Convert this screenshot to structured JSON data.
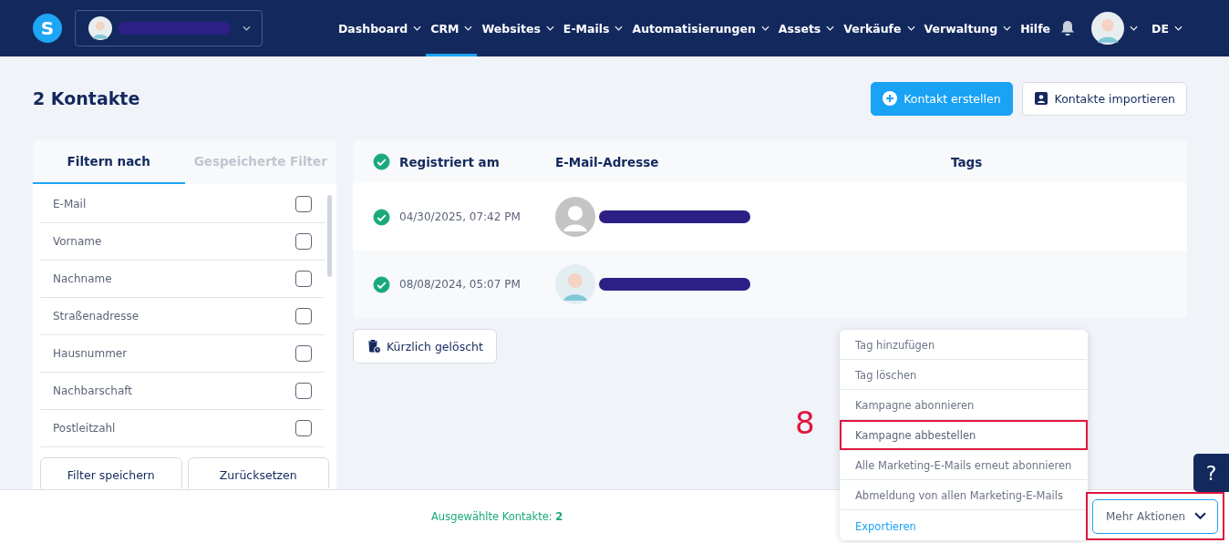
{
  "nav": {
    "logo": "S",
    "items": [
      {
        "label": "Dashboard",
        "dropdown": true,
        "selected": false
      },
      {
        "label": "CRM",
        "dropdown": true,
        "selected": true
      },
      {
        "label": "Websites",
        "dropdown": true,
        "selected": false
      },
      {
        "label": "E-Mails",
        "dropdown": true,
        "selected": false
      },
      {
        "label": "Automatisierungen",
        "dropdown": true,
        "selected": false
      },
      {
        "label": "Assets",
        "dropdown": true,
        "selected": false
      },
      {
        "label": "Verkäufe",
        "dropdown": true,
        "selected": false
      },
      {
        "label": "Verwaltung",
        "dropdown": true,
        "selected": false
      },
      {
        "label": "Hilfe",
        "dropdown": false,
        "selected": false
      }
    ],
    "language": "DE"
  },
  "page": {
    "title": "2 Kontakte",
    "buttons": [
      {
        "label": "Kontakt erstellen",
        "kind": "primary"
      },
      {
        "label": "Kontakte importieren",
        "kind": "secondary"
      }
    ]
  },
  "filter_panel": {
    "tabs": [
      {
        "label": "Filtern nach",
        "selected": true
      },
      {
        "label": "Gespeicherte Filter",
        "selected": false
      }
    ],
    "fields": [
      {
        "label": "E-Mail",
        "checked": false
      },
      {
        "label": "Vorname",
        "checked": false
      },
      {
        "label": "Nachname",
        "checked": false
      },
      {
        "label": "Straßenadresse",
        "checked": false
      },
      {
        "label": "Hausnummer",
        "checked": false
      },
      {
        "label": "Nachbarschaft",
        "checked": false
      },
      {
        "label": "Postleitzahl",
        "checked": false
      }
    ],
    "buttons": [
      "Filter speichern",
      "Zurücksetzen"
    ]
  },
  "table": {
    "columns": [
      "Registriert am",
      "E-Mail-Adresse",
      "Tags"
    ],
    "all_selected": true,
    "rows": [
      {
        "selected": true,
        "registered": "04/30/2025, 07:42 PM",
        "kind": "placeholder"
      },
      {
        "selected": true,
        "registered": "08/08/2024, 05:07 PM",
        "kind": "illustration"
      }
    ]
  },
  "recently_deleted": "Kürzlich gelöscht",
  "actions_menu": {
    "items": [
      {
        "label": "Tag hinzufügen",
        "kind": "action",
        "highlighted": false
      },
      {
        "label": "Tag löschen",
        "kind": "action",
        "highlighted": false
      },
      {
        "label": "Kampagne abonnieren",
        "kind": "action",
        "highlighted": false
      },
      {
        "label": "Kampagne abbestellen",
        "kind": "action",
        "highlighted": true
      },
      {
        "label": "Alle Marketing-E-Mails erneut abonnieren",
        "kind": "action",
        "highlighted": false
      },
      {
        "label": "Abmeldung von allen Marketing-E-Mails",
        "kind": "action",
        "highlighted": false
      },
      {
        "label": "Exportieren",
        "kind": "link",
        "highlighted": false
      }
    ]
  },
  "annotation": {
    "step": "8"
  },
  "footer": {
    "selected_label": "Ausgewählte Kontakte:",
    "selected_count": "2",
    "more_actions": {
      "label": "Mehr Aktionen",
      "highlighted": true
    }
  },
  "help_button": "?"
}
